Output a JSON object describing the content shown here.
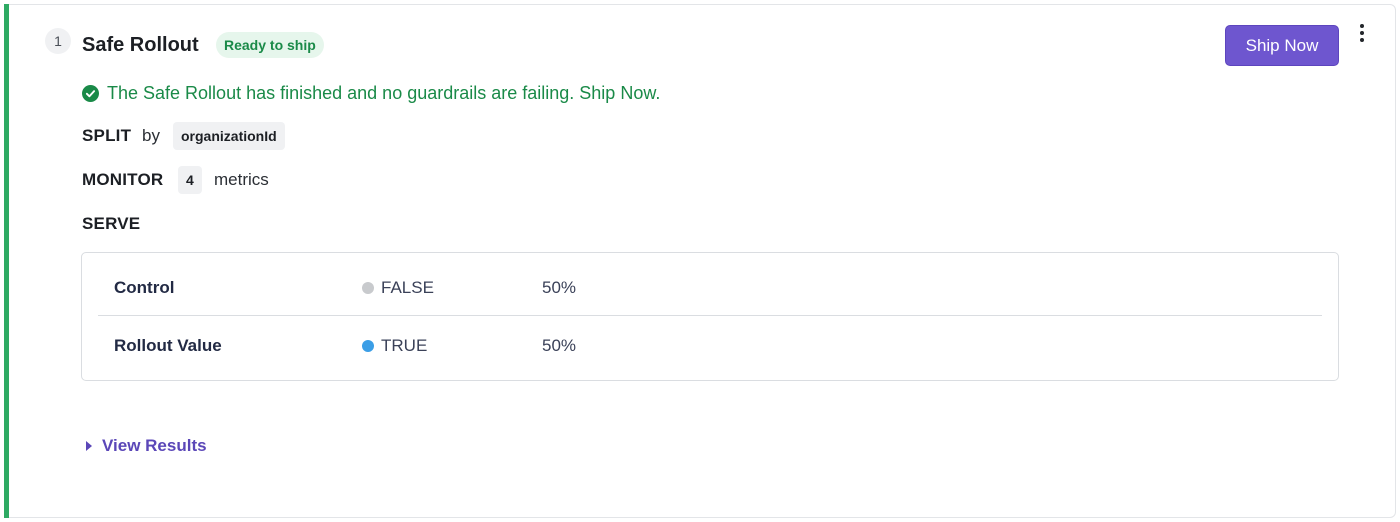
{
  "step": {
    "number": "1"
  },
  "header": {
    "title": "Safe Rollout",
    "badge": "Ready to ship",
    "ship_button": "Ship Now"
  },
  "status_message": "The Safe Rollout has finished and no guardrails are failing. Ship Now.",
  "split": {
    "label": "SPLIT",
    "connector": "by",
    "attribute": "organizationId"
  },
  "monitor": {
    "label": "MONITOR",
    "count": "4",
    "unit": "metrics"
  },
  "serve": {
    "label": "SERVE",
    "rows": [
      {
        "name": "Control",
        "value": "FALSE",
        "percent": "50%",
        "dot_color": "#c8cacd"
      },
      {
        "name": "Rollout Value",
        "value": "TRUE",
        "percent": "50%",
        "dot_color": "#3b9ee6"
      }
    ]
  },
  "view_results": "View Results",
  "colors": {
    "accent": "#2eaa63",
    "primary": "#6e56cf",
    "success_text": "#1a8a48",
    "link": "#5b47b8"
  },
  "icons": {
    "status": "check-circle-icon",
    "menu": "more-vertical-icon",
    "expand": "caret-right-icon"
  }
}
